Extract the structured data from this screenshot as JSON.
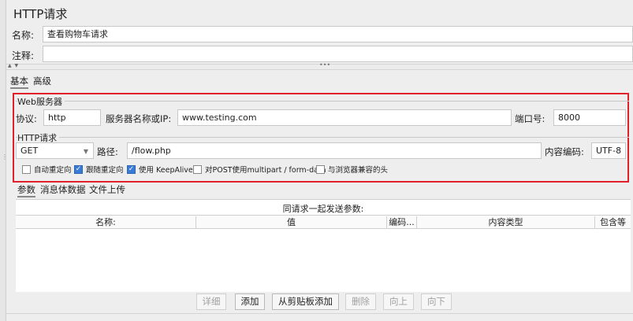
{
  "title": "HTTP请求",
  "name_label": "名称:",
  "name_value": "查看购物车请求",
  "comment_label": "注释:",
  "comment_value": "",
  "splitter_arrows": "▲ ▼",
  "splitter_dots": "•••",
  "tabs": [
    "基本",
    "高级"
  ],
  "web_server": {
    "group_title": "Web服务器",
    "protocol_label": "协议:",
    "protocol_value": "http",
    "server_label": "服务器名称或IP:",
    "server_value": "www.testing.com",
    "port_label": "端口号:",
    "port_value": "8000"
  },
  "http_request": {
    "group_title": "HTTP请求",
    "method_value": "GET",
    "path_label": "路径:",
    "path_value": "/flow.php",
    "encoding_label": "内容编码:",
    "encoding_value": "UTF-8"
  },
  "checkboxes": [
    {
      "label": "自动重定向",
      "checked": false
    },
    {
      "label": "跟随重定向",
      "checked": true
    },
    {
      "label": "使用 KeepAlive",
      "checked": true
    },
    {
      "label": "对POST使用multipart / form-data",
      "checked": false
    },
    {
      "label": "与浏览器兼容的头",
      "checked": false
    }
  ],
  "subtabs": [
    "参数",
    "消息体数据",
    "文件上传"
  ],
  "params_caption": "同请求一起发送参数:",
  "columns": [
    "名称:",
    "值",
    "编码...",
    "内容类型",
    "包含等"
  ],
  "buttons": [
    {
      "label": "详细",
      "enabled": false
    },
    {
      "label": "添加",
      "enabled": true
    },
    {
      "label": "从剪贴板添加",
      "enabled": true
    },
    {
      "label": "删除",
      "enabled": false
    },
    {
      "label": "向上",
      "enabled": false
    },
    {
      "label": "向下",
      "enabled": false
    }
  ],
  "colors": {
    "highlight_box": "#e0202a",
    "checkbox_checked": "#3a7bd5"
  }
}
